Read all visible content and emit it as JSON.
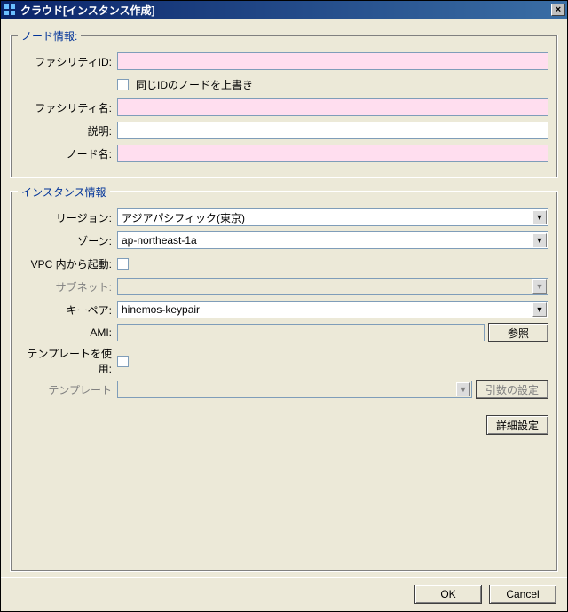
{
  "window": {
    "title": "クラウド[インスタンス作成]",
    "close_label": "×"
  },
  "node": {
    "legend": "ノード情報:",
    "facility_id_label": "ファシリティID:",
    "facility_id": "",
    "overwrite_label": "同じIDのノードを上書き",
    "facility_name_label": "ファシリティ名:",
    "facility_name": "",
    "description_label": "説明:",
    "description": "",
    "node_name_label": "ノード名:",
    "node_name": ""
  },
  "instance": {
    "legend": "インスタンス情報",
    "region_label": "リージョン:",
    "region_value": "アジアパシフィック(東京)",
    "zone_label": "ゾーン:",
    "zone_value": "ap-northeast-1a",
    "vpc_launch_label": "VPC 内から起動:",
    "subnet_label": "サブネット:",
    "subnet_value": "",
    "keypair_label": "キーペア:",
    "keypair_value": "hinemos-keypair",
    "ami_label": "AMI:",
    "ami_value": "",
    "browse_label": "参照",
    "use_template_label": "テンプレートを使用:",
    "template_label": "テンプレート",
    "template_value": "",
    "args_label": "引数の設定",
    "detailed_label": "詳細設定"
  },
  "footer": {
    "ok": "OK",
    "cancel": "Cancel"
  }
}
